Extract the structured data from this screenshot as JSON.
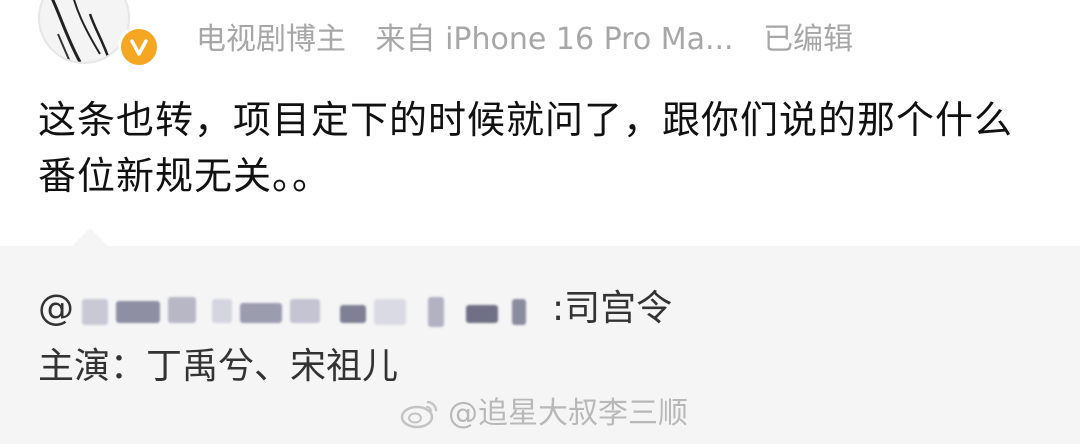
{
  "post": {
    "meta": {
      "label": "电视剧博主",
      "source": "来自 iPhone 16 Pro Ma...",
      "edited": "已编辑"
    },
    "text": "这条也转，项目定下的时候就问了，跟你们说的那个什么番位新规无关。。",
    "badge_color": "#f5a623"
  },
  "repost": {
    "at_prefix": "@",
    "source_suffix": ":司宫令",
    "cast_line": "主演：丁禹兮、宋祖儿"
  },
  "watermark": {
    "icon": "weibo-logo-icon",
    "text": "@追星大叔李三顺"
  }
}
